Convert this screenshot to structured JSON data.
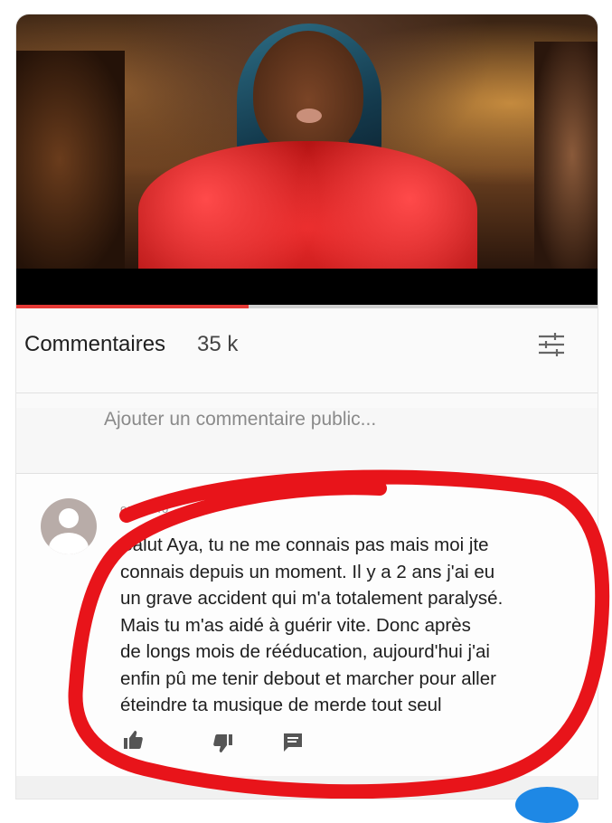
{
  "video": {
    "progress_fraction": 0.4
  },
  "comments": {
    "title": "Commentaires",
    "count": "35 k",
    "sort_icon": "sort-filter-icon",
    "add_placeholder": "Ajouter un commentaire public..."
  },
  "comment": {
    "author": "oze fofo",
    "text": "Salut Aya, tu ne me connais pas mais moi jte\nconnais depuis un moment. Il y a 2 ans j'ai eu\nun grave accident qui m'a totalement paralysé.\nMais tu m'as aidé à guérir vite. Donc après\nde longs mois de rééducation, aujourd'hui j'ai\nenfin pû me tenir debout et marcher pour aller\néteindre ta musique de merde tout seul",
    "actions": [
      "thumbs-up-icon",
      "thumbs-down-icon",
      "reply-icon"
    ]
  },
  "colors": {
    "accent_red": "#e53935",
    "annotation_red": "#e8141a",
    "fab_blue": "#1e88e5"
  }
}
